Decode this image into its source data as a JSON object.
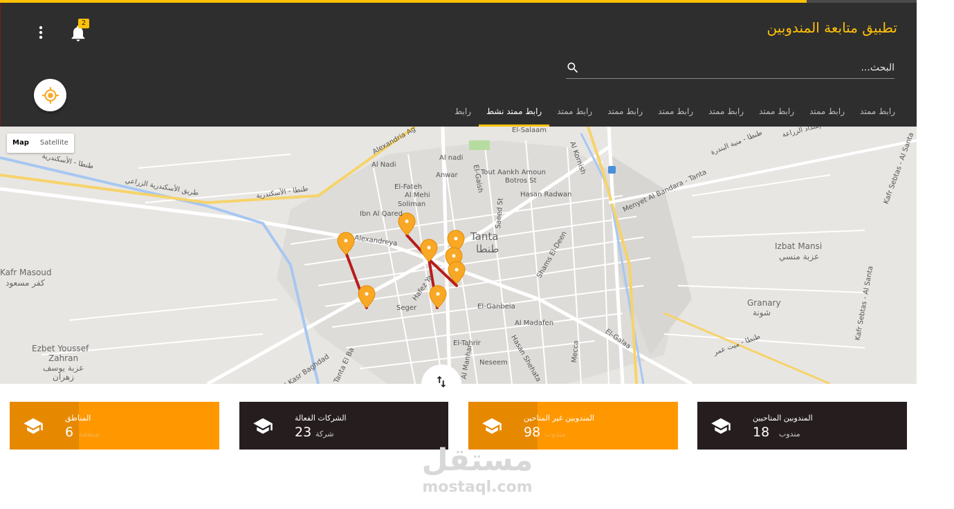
{
  "progress": {
    "fraction": 0.88
  },
  "header": {
    "title": "تطبيق متابعة المندوبين",
    "notifications_count": "2",
    "search_placeholder": "البحث..."
  },
  "tabs": [
    {
      "label": "رابط",
      "active": false
    },
    {
      "label": "رابط ممتد نشط",
      "active": true
    },
    {
      "label": "رابط ممتد",
      "active": false
    },
    {
      "label": "رابط ممتد",
      "active": false
    },
    {
      "label": "رابط ممتد",
      "active": false
    },
    {
      "label": "رابط ممتد",
      "active": false
    },
    {
      "label": "رابط ممتد",
      "active": false
    },
    {
      "label": "رابط ممتد",
      "active": false
    },
    {
      "label": "رابط ممتد",
      "active": false
    }
  ],
  "map": {
    "type_buttons": [
      "Map",
      "Satellite"
    ],
    "active_type": "Map",
    "labels": {
      "tanta_en": "Tanta",
      "tanta_ar": "طنطا",
      "izbat_mansi_en": "Izbat Mansi",
      "izbat_mansi_ar": "عزبة منسي",
      "kafr_masoud_en": "Kafr Masoud",
      "kafr_masoud_ar": "كفر مسعود",
      "ezbet_youssef_en": "Ezbet Youssef",
      "ezbet_youssef_en2": "Zahran",
      "ezbet_youssef_ar": "عزبة يوسف",
      "ezbet_youssef_ar2": "زهران",
      "granary_en": "Granary",
      "granary_ar": "شونة",
      "alexandria_rd": "Alexandria Ag",
      "al_nadi": "Al Nadi",
      "el_fateh": "El-Fateh",
      "al_mehi": "Al Mehi",
      "soliman": "Soliman",
      "ibn_al_qared": "Ibn Al Qared",
      "tout_ankh_amoun": "Tout Aankh Amoun",
      "botros_st": "Botros St",
      "hasan_radwan": "Hasan Radwan",
      "alexandreya": "Alexandreya",
      "hafez": "Hafez Ya",
      "seger": "Seger",
      "el_ganbeia": "El-Ganbeia",
      "al_madafen": "Al Madafen",
      "el_tahrir": "El-Tahrir",
      "neseem": "Neseem",
      "hasan_shehata": "Hasan Shehata",
      "mecca": "Mecca",
      "el_galaa": "El-Galaa",
      "menyet": "Menyet Al Bandara - Tanta",
      "kafr_sebtas": "Kafr Sebtas - Al Santa",
      "kafr_sebtas2": "Kafr Sebtas - Al Santa",
      "shams_el_deen": "Shams El-Deen",
      "al_kornish": "Al Kornish",
      "anwar": "Anwar",
      "al_nadi2": "Al nadi",
      "el_gaish": "El-Gaish",
      "saeed": "Saeed St",
      "kasr_baghdad": "Al Kasr Baghdad",
      "tanta_el_ba": "Tanta El Ba",
      "tanta_alex_ar": "طنطا - الأسكندرية",
      "tanta_alex_ar2": "طنطا - الأسكندرية",
      "agri_road_ar": "طريق الأسكندرية الزراعي",
      "tanta_mit_ghamr_ar": "طنطا - ميت عمر",
      "tanta_bandara_ar": "طنطا - منية البندرة",
      "zeraa_ar": "إمتداد الزراعة",
      "al_manhar": "Al Manhar",
      "el_salam": "El-Salaam"
    },
    "pins_count": 9
  },
  "stats": [
    {
      "label": "المندوبين المتاحيين",
      "value": "18",
      "unit": "مندوب",
      "variant": "dark"
    },
    {
      "label": "المندوبين غير المتاحين",
      "value": "98",
      "unit": "مندوب",
      "variant": "orange"
    },
    {
      "label": "الشركات الفعالة",
      "value": "23",
      "unit": "شركة",
      "variant": "dark"
    },
    {
      "label": "المناطق",
      "value": "6",
      "unit": "منطقة",
      "variant": "orange"
    }
  ],
  "watermark": {
    "arabic": "مستقل",
    "latin": "mostaql.com"
  },
  "colors": {
    "accent": "#ffc107",
    "header_bg": "#2e2e2e",
    "card_dark": "#261e1e",
    "card_orange": "#ff9800",
    "route": "#b71c1c",
    "pin": "#f9a825"
  }
}
